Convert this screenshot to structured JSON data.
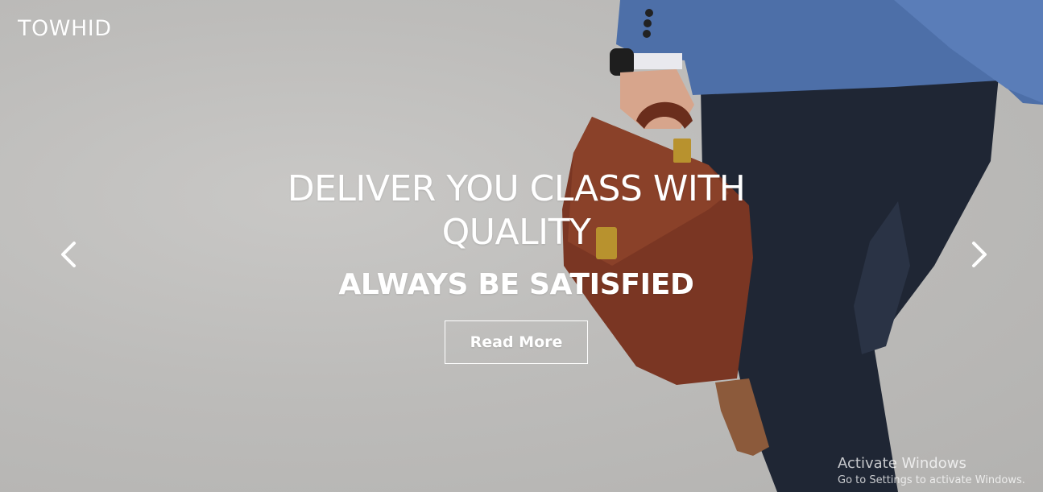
{
  "brand": {
    "logo_text": "TOWHID"
  },
  "slide": {
    "headline": "DELIVER YOU CLASS WITH QUALITY",
    "subheadline": "ALWAYS BE SATISFIED",
    "cta_label": "Read More"
  },
  "carousel": {
    "prev_icon": "chevron-left-icon",
    "next_icon": "chevron-right-icon"
  },
  "os_watermark": {
    "title": "Activate Windows",
    "subtitle": "Go to Settings to activate Windows."
  },
  "colors": {
    "background": "#c0bfbd",
    "text": "#ffffff",
    "jacket": "#4d6fa8",
    "trousers": "#1f2634",
    "briefcase": "#7a3623"
  }
}
